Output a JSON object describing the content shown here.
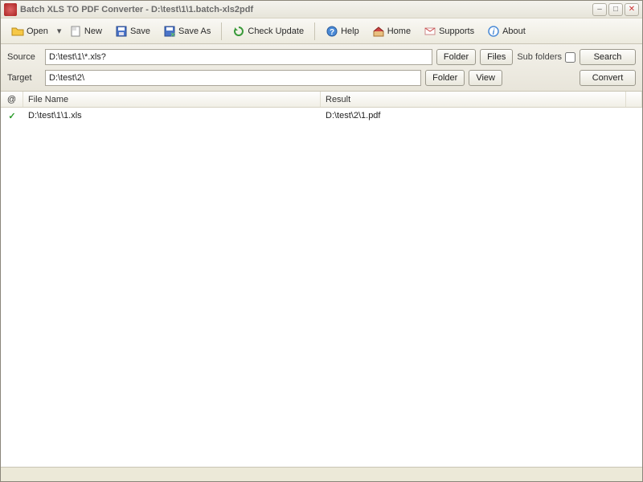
{
  "window": {
    "title": "Batch XLS TO PDF Converter - D:\\test\\1\\1.batch-xls2pdf"
  },
  "toolbar": {
    "open": "Open",
    "new": "New",
    "save": "Save",
    "saveas": "Save As",
    "check": "Check Update",
    "help": "Help",
    "home": "Home",
    "supports": "Supports",
    "about": "About"
  },
  "paths": {
    "source_label": "Source",
    "source_value": "D:\\test\\1\\*.xls?",
    "target_label": "Target",
    "target_value": "D:\\test\\2\\",
    "folder_btn": "Folder",
    "files_btn": "Files",
    "view_btn": "View",
    "sub_folders": "Sub folders",
    "search_btn": "Search",
    "convert_btn": "Convert"
  },
  "columns": {
    "status": "@",
    "filename": "File Name",
    "result": "Result"
  },
  "rows": [
    {
      "status": "✓",
      "filename": "D:\\test\\1\\1.xls",
      "result": "D:\\test\\2\\1.pdf"
    }
  ]
}
